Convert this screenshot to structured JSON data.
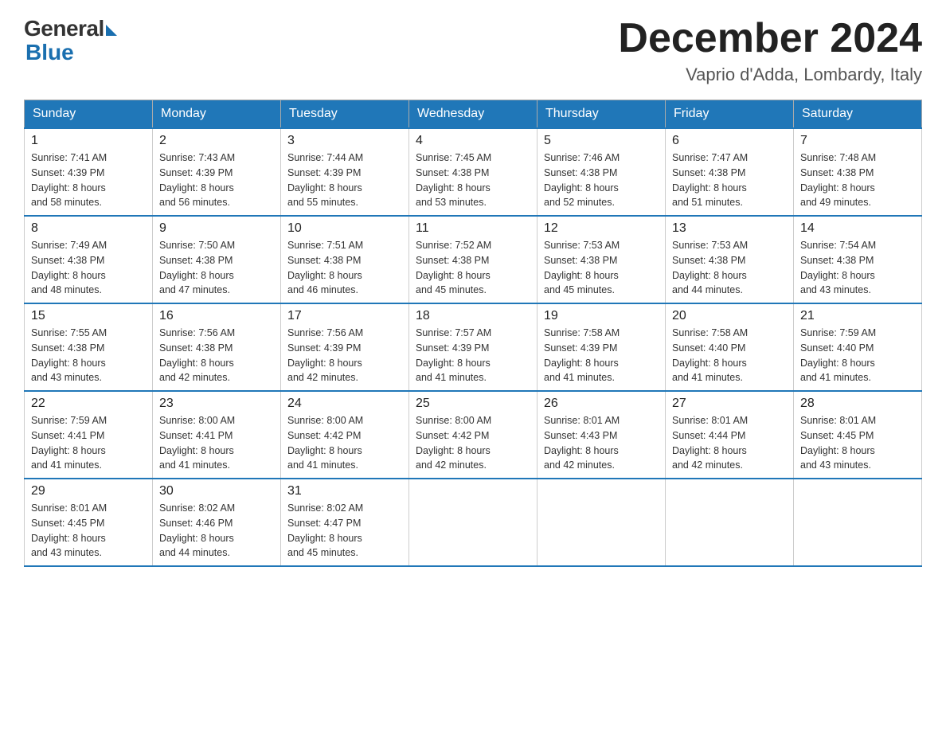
{
  "header": {
    "logo_general": "General",
    "logo_blue": "Blue",
    "month_year": "December 2024",
    "location": "Vaprio d'Adda, Lombardy, Italy"
  },
  "weekdays": [
    "Sunday",
    "Monday",
    "Tuesday",
    "Wednesday",
    "Thursday",
    "Friday",
    "Saturday"
  ],
  "weeks": [
    [
      {
        "day": "1",
        "sunrise": "7:41 AM",
        "sunset": "4:39 PM",
        "daylight": "8 hours and 58 minutes."
      },
      {
        "day": "2",
        "sunrise": "7:43 AM",
        "sunset": "4:39 PM",
        "daylight": "8 hours and 56 minutes."
      },
      {
        "day": "3",
        "sunrise": "7:44 AM",
        "sunset": "4:39 PM",
        "daylight": "8 hours and 55 minutes."
      },
      {
        "day": "4",
        "sunrise": "7:45 AM",
        "sunset": "4:38 PM",
        "daylight": "8 hours and 53 minutes."
      },
      {
        "day": "5",
        "sunrise": "7:46 AM",
        "sunset": "4:38 PM",
        "daylight": "8 hours and 52 minutes."
      },
      {
        "day": "6",
        "sunrise": "7:47 AM",
        "sunset": "4:38 PM",
        "daylight": "8 hours and 51 minutes."
      },
      {
        "day": "7",
        "sunrise": "7:48 AM",
        "sunset": "4:38 PM",
        "daylight": "8 hours and 49 minutes."
      }
    ],
    [
      {
        "day": "8",
        "sunrise": "7:49 AM",
        "sunset": "4:38 PM",
        "daylight": "8 hours and 48 minutes."
      },
      {
        "day": "9",
        "sunrise": "7:50 AM",
        "sunset": "4:38 PM",
        "daylight": "8 hours and 47 minutes."
      },
      {
        "day": "10",
        "sunrise": "7:51 AM",
        "sunset": "4:38 PM",
        "daylight": "8 hours and 46 minutes."
      },
      {
        "day": "11",
        "sunrise": "7:52 AM",
        "sunset": "4:38 PM",
        "daylight": "8 hours and 45 minutes."
      },
      {
        "day": "12",
        "sunrise": "7:53 AM",
        "sunset": "4:38 PM",
        "daylight": "8 hours and 45 minutes."
      },
      {
        "day": "13",
        "sunrise": "7:53 AM",
        "sunset": "4:38 PM",
        "daylight": "8 hours and 44 minutes."
      },
      {
        "day": "14",
        "sunrise": "7:54 AM",
        "sunset": "4:38 PM",
        "daylight": "8 hours and 43 minutes."
      }
    ],
    [
      {
        "day": "15",
        "sunrise": "7:55 AM",
        "sunset": "4:38 PM",
        "daylight": "8 hours and 43 minutes."
      },
      {
        "day": "16",
        "sunrise": "7:56 AM",
        "sunset": "4:38 PM",
        "daylight": "8 hours and 42 minutes."
      },
      {
        "day": "17",
        "sunrise": "7:56 AM",
        "sunset": "4:39 PM",
        "daylight": "8 hours and 42 minutes."
      },
      {
        "day": "18",
        "sunrise": "7:57 AM",
        "sunset": "4:39 PM",
        "daylight": "8 hours and 41 minutes."
      },
      {
        "day": "19",
        "sunrise": "7:58 AM",
        "sunset": "4:39 PM",
        "daylight": "8 hours and 41 minutes."
      },
      {
        "day": "20",
        "sunrise": "7:58 AM",
        "sunset": "4:40 PM",
        "daylight": "8 hours and 41 minutes."
      },
      {
        "day": "21",
        "sunrise": "7:59 AM",
        "sunset": "4:40 PM",
        "daylight": "8 hours and 41 minutes."
      }
    ],
    [
      {
        "day": "22",
        "sunrise": "7:59 AM",
        "sunset": "4:41 PM",
        "daylight": "8 hours and 41 minutes."
      },
      {
        "day": "23",
        "sunrise": "8:00 AM",
        "sunset": "4:41 PM",
        "daylight": "8 hours and 41 minutes."
      },
      {
        "day": "24",
        "sunrise": "8:00 AM",
        "sunset": "4:42 PM",
        "daylight": "8 hours and 41 minutes."
      },
      {
        "day": "25",
        "sunrise": "8:00 AM",
        "sunset": "4:42 PM",
        "daylight": "8 hours and 42 minutes."
      },
      {
        "day": "26",
        "sunrise": "8:01 AM",
        "sunset": "4:43 PM",
        "daylight": "8 hours and 42 minutes."
      },
      {
        "day": "27",
        "sunrise": "8:01 AM",
        "sunset": "4:44 PM",
        "daylight": "8 hours and 42 minutes."
      },
      {
        "day": "28",
        "sunrise": "8:01 AM",
        "sunset": "4:45 PM",
        "daylight": "8 hours and 43 minutes."
      }
    ],
    [
      {
        "day": "29",
        "sunrise": "8:01 AM",
        "sunset": "4:45 PM",
        "daylight": "8 hours and 43 minutes."
      },
      {
        "day": "30",
        "sunrise": "8:02 AM",
        "sunset": "4:46 PM",
        "daylight": "8 hours and 44 minutes."
      },
      {
        "day": "31",
        "sunrise": "8:02 AM",
        "sunset": "4:47 PM",
        "daylight": "8 hours and 45 minutes."
      },
      null,
      null,
      null,
      null
    ]
  ],
  "labels": {
    "sunrise": "Sunrise:",
    "sunset": "Sunset:",
    "daylight": "Daylight:"
  }
}
